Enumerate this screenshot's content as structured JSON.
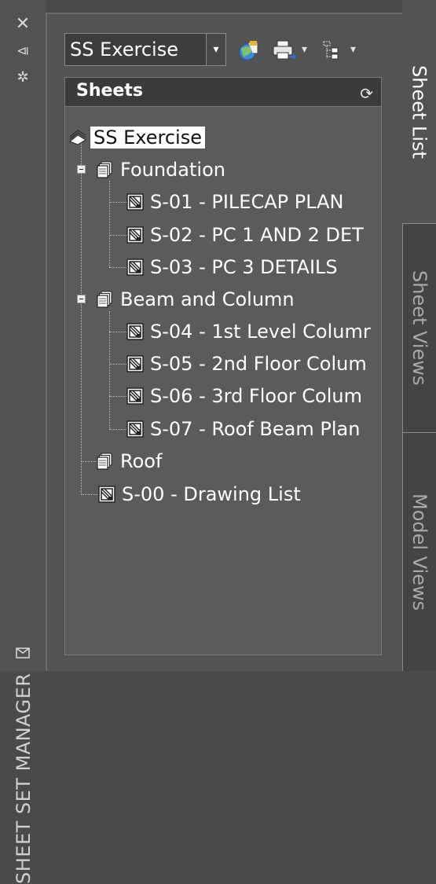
{
  "palette": {
    "title": "SHEET SET MANAGER"
  },
  "toolbar": {
    "sheet_set_selector": {
      "value": "SS Exercise"
    }
  },
  "sheets_header": {
    "title": "Sheets"
  },
  "tree": {
    "root": "SS Exercise",
    "foundation": {
      "label": "Foundation",
      "sheets": [
        "S-01 - PILECAP PLAN",
        "S-02 - PC 1 AND 2 DET",
        "S-03 - PC 3 DETAILS"
      ]
    },
    "beam_column": {
      "label": "Beam and Column",
      "sheets": [
        "S-04 - 1st Level Columr",
        "S-05 - 2nd Floor Colum",
        "S-06 - 3rd Floor Colum",
        "S-07 - Roof Beam Plan"
      ]
    },
    "roof": {
      "label": "Roof"
    },
    "drawing_list": "S-00 - Drawing List"
  },
  "tabs": [
    "Sheet List",
    "Sheet Views",
    "Model Views"
  ],
  "colors": {
    "background": "#4a4a4a",
    "panel": "#535353",
    "tree_background": "#5b5b5b",
    "header": "#3b3b3b",
    "selection": "#ffffff",
    "text": "#ffffff"
  },
  "icons": {
    "close": "close-icon",
    "autohide": "autohide-icon",
    "properties": "properties-icon",
    "palette_menu": "palette-menu-icon",
    "publish": "publish-icon",
    "plot": "plot-icon",
    "sheet_selection": "sheet-selection-icon",
    "refresh": "refresh-icon",
    "sheet_set": "sheet-set-icon",
    "subset": "subset-icon",
    "sheet": "sheet-icon"
  }
}
